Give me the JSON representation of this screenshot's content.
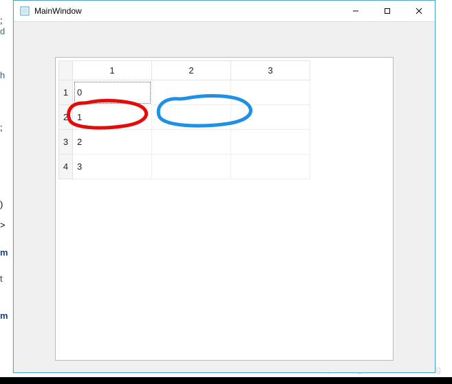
{
  "window": {
    "title": "MainWindow",
    "minimize_label": "Minimize",
    "maximize_label": "Maximize",
    "close_label": "Close"
  },
  "table": {
    "columns": [
      "1",
      "2",
      "3"
    ],
    "rows": [
      {
        "header": "1",
        "cells": [
          "0",
          "",
          ""
        ]
      },
      {
        "header": "2",
        "cells": [
          "1",
          "",
          ""
        ]
      },
      {
        "header": "3",
        "cells": [
          "2",
          "",
          ""
        ]
      },
      {
        "header": "4",
        "cells": [
          "3",
          "",
          ""
        ]
      }
    ]
  },
  "annotations": {
    "red_circle": {
      "target": "cell r2 c1"
    },
    "blue_circle": {
      "target": "cell r2 c2"
    }
  },
  "background_fragments": [
    ";",
    "d",
    "h",
    ";",
    ")",
    ">",
    "m",
    "t",
    "m"
  ],
  "watermark": "https://blog.csdn.net/CCLasdfg"
}
